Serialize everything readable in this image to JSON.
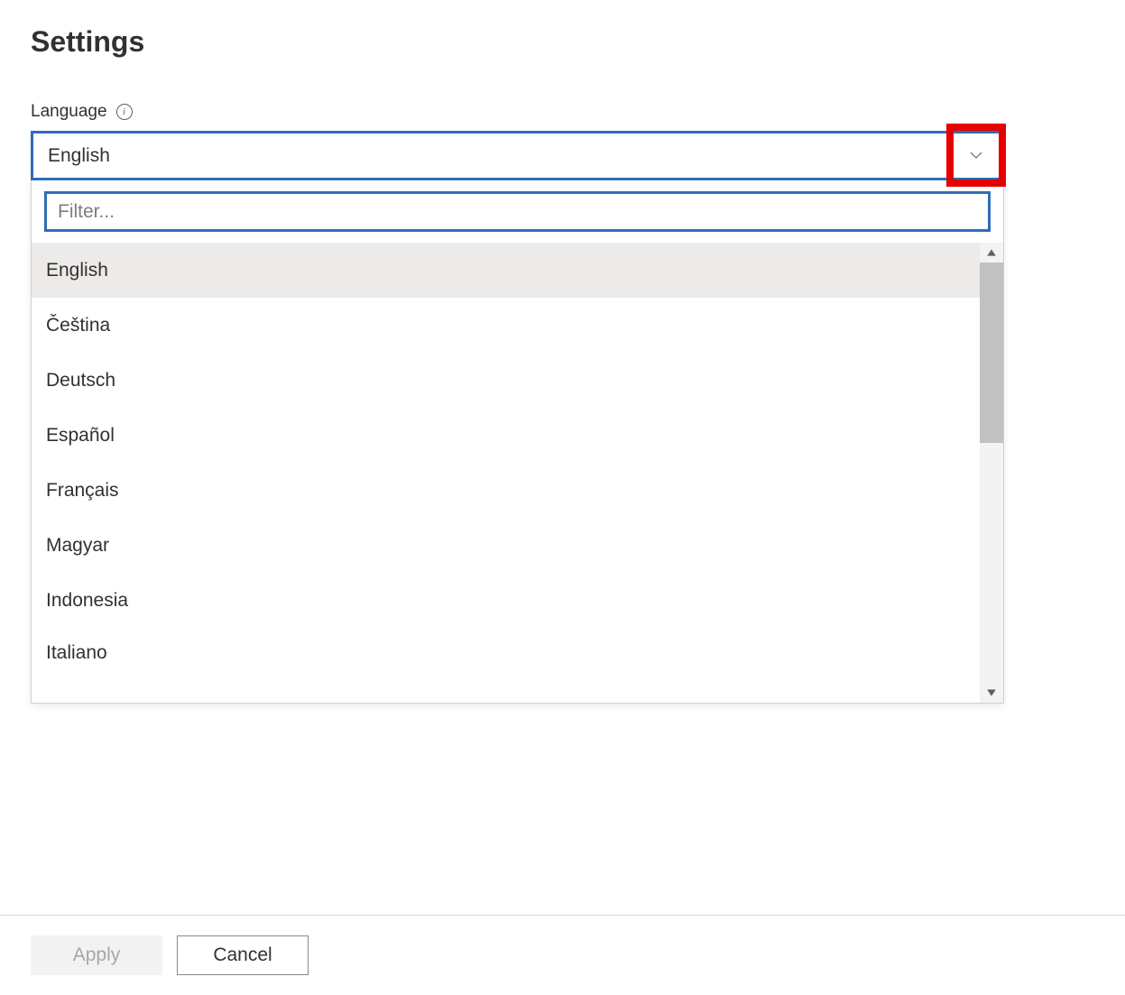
{
  "page": {
    "title": "Settings"
  },
  "language": {
    "label": "Language",
    "selected": "English",
    "filter_placeholder": "Filter...",
    "options": [
      "English",
      "Čeština",
      "Deutsch",
      "Español",
      "Français",
      "Magyar",
      "Indonesia",
      "Italiano"
    ]
  },
  "footer": {
    "apply_label": "Apply",
    "cancel_label": "Cancel"
  },
  "icons": {
    "info": "info-icon",
    "chevron_down": "chevron-down-icon",
    "scroll_up": "scroll-up-arrow",
    "scroll_down": "scroll-down-arrow"
  },
  "highlight": {
    "target": "dropdown-chevron",
    "color": "#e60000"
  }
}
